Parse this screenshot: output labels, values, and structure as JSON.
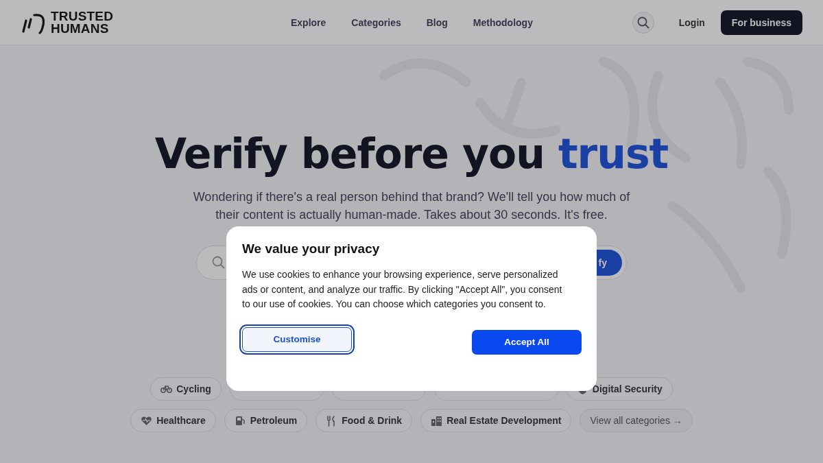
{
  "header": {
    "logo_text": "TRUSTED HUMANS",
    "nav": [
      {
        "label": "Explore"
      },
      {
        "label": "Categories"
      },
      {
        "label": "Blog"
      },
      {
        "label": "Methodology"
      }
    ],
    "login": "Login",
    "business_button": "For business"
  },
  "hero": {
    "title_parts": [
      {
        "text": "Verify before you ",
        "accent": false
      },
      {
        "text": "trust",
        "accent": true
      }
    ],
    "subtitle": "Wondering if there's a real person behind that brand? We'll tell you how much of their content is actually human-made. Takes about 30 seconds. It's free.",
    "search_button": "fy"
  },
  "category_rows": [
    [
      {
        "kind": "chip",
        "label": "Cycling"
      },
      {
        "kind": "covered"
      },
      {
        "kind": "covered"
      },
      {
        "kind": "covered"
      },
      {
        "kind": "chip",
        "label": "Digital Security"
      }
    ],
    [
      {
        "kind": "chip",
        "label": "Healthcare"
      },
      {
        "kind": "chip",
        "label": "Petroleum"
      },
      {
        "kind": "chip",
        "label": "Food & Drink"
      },
      {
        "kind": "chip",
        "label": "Real Estate Development"
      },
      {
        "kind": "link",
        "label": "View all categories →"
      }
    ]
  ],
  "cookie_dialog": {
    "title": "We value your privacy",
    "text": "We use cookies to enhance your browsing experience, serve personalized ads or content, and analyze our traffic. By clicking \"Accept All\", you consent to our use of cookies. You can choose which categories you consent to.",
    "buttons": [
      {
        "label": "Customise",
        "kind": "secondary",
        "focused": true
      },
      {
        "label": "Accept All",
        "kind": "primary",
        "focused": false
      }
    ]
  }
}
